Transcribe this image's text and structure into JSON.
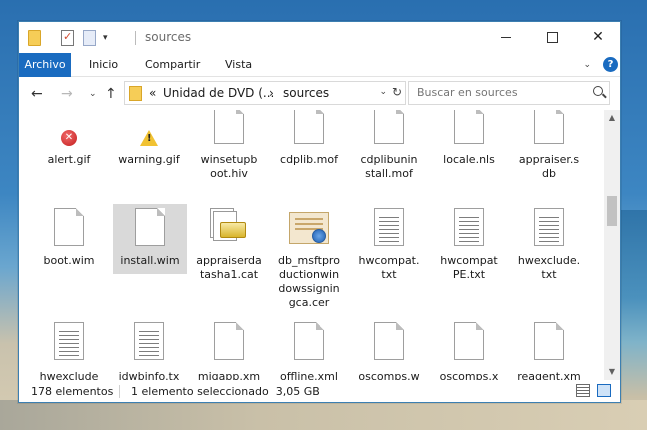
{
  "window": {
    "title": "sources"
  },
  "ribbon": {
    "tabs": [
      "Archivo",
      "Inicio",
      "Compartir",
      "Vista"
    ],
    "help": "?"
  },
  "address": {
    "overflow": "«",
    "crumbs": [
      "Unidad de DVD (...",
      "sources"
    ],
    "separator": "›"
  },
  "search": {
    "placeholder": "Buscar en sources"
  },
  "files": [
    {
      "name": "alert.gif",
      "icon": "error-gif-icon"
    },
    {
      "name": "warning.gif",
      "icon": "warning-gif-icon"
    },
    {
      "name": "winsetupboot.hiv",
      "icon": "file-icon"
    },
    {
      "name": "cdplib.mof",
      "icon": "file-icon"
    },
    {
      "name": "cdplibuninstall.mof",
      "icon": "file-icon"
    },
    {
      "name": "locale.nls",
      "icon": "file-icon"
    },
    {
      "name": "appraiser.sdb",
      "icon": "file-icon"
    },
    {
      "name": "boot.wim",
      "icon": "file-icon"
    },
    {
      "name": "install.wim",
      "icon": "file-icon"
    },
    {
      "name": "appraiserdatasha1.cat",
      "icon": "catalog-icon"
    },
    {
      "name": "db_msftproductionwindowssigningca.cer",
      "icon": "certificate-icon"
    },
    {
      "name": "hwcompat.txt",
      "icon": "text-file-icon"
    },
    {
      "name": "hwcompatPE.txt",
      "icon": "text-file-icon"
    },
    {
      "name": "hwexclude.txt",
      "icon": "text-file-icon"
    },
    {
      "name": "hwexcludePE.txt",
      "icon": "text-file-icon"
    },
    {
      "name": "idwbinfo.txt",
      "icon": "text-file-icon"
    },
    {
      "name": "migapp.xml",
      "icon": "file-icon"
    },
    {
      "name": "offline.xml",
      "icon": "file-icon"
    },
    {
      "name": "oscomps.woa.xml",
      "icon": "file-icon"
    },
    {
      "name": "oscomps.xml",
      "icon": "file-icon"
    },
    {
      "name": "reagent.xml",
      "icon": "file-icon"
    }
  ],
  "labels": {
    "r0": [
      "alert.gif",
      "warning.gif",
      "winsetupb\noot.hiv",
      "cdplib.mof",
      "cdplibunin\nstall.mof",
      "locale.nls",
      "appraiser.s\ndb"
    ],
    "r1": [
      "boot.wim",
      "install.wim",
      "appraiserda\ntasha1.cat",
      "db_msftpro\nductionwin\ndowssignin\ngca.cer",
      "hwcompat.\ntxt",
      "hwcompat\nPE.txt",
      "hwexclude.\ntxt"
    ],
    "r2": [
      "hwexclude\nPE.txt",
      "idwbinfo.tx\nt",
      "migapp.xm\nl",
      "offline.xml",
      "oscomps.w\noa.xml",
      "oscomps.x\nml",
      "reagent.xm\nl"
    ]
  },
  "selected_file": "install.wim",
  "status": {
    "count": "178 elementos",
    "selection": "1 elemento seleccionado  3,05 GB"
  },
  "colors": {
    "accent": "#1a6bc0",
    "selection": "#d9d9d9"
  }
}
